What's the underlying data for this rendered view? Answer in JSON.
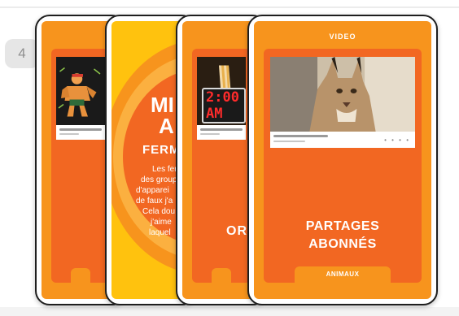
{
  "step": {
    "number": "4"
  },
  "phones": {
    "phone2": {
      "line1": "MI",
      "line2": "A",
      "line3": "FERM",
      "body": [
        "Les ferm",
        "des group",
        "d'apparei",
        "de faux j'a",
        "Cela dou",
        "j'aime",
        "laquel"
      ]
    },
    "phone3": {
      "clock": "2:00 AM",
      "label": "OR"
    },
    "phone4": {
      "header": "VIDEO",
      "title_line1": "PARTAGES",
      "title_line2": "ABONNÉS",
      "tab": "ANIMAUX"
    }
  },
  "colors": {
    "orange": "#f7941d",
    "deep_orange": "#f26722",
    "yellow": "#ffc20e",
    "badge_bg": "#e6e6e6",
    "frame": "#1e1e1e"
  }
}
